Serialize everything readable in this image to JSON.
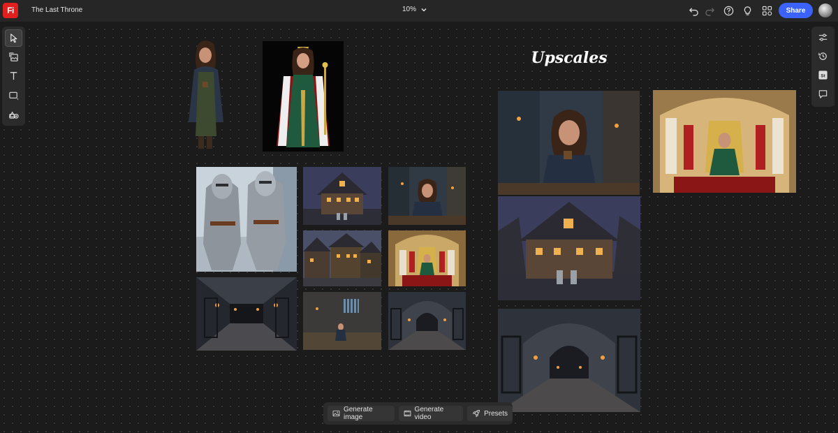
{
  "app": {
    "logo_text": "Fi",
    "document_title": "The Last Throne",
    "zoom_level": "10%"
  },
  "topbar": {
    "share_label": "Share",
    "icons": [
      "undo-icon",
      "redo-icon",
      "help-icon",
      "lightbulb-icon",
      "apps-icon"
    ]
  },
  "canvas": {
    "heading": "Upscales"
  },
  "left_toolbar": {
    "tools": [
      "select-tool",
      "add-image-tool",
      "text-tool",
      "shape-tool",
      "generate-tool"
    ]
  },
  "right_toolbar": {
    "tools": [
      "adjustments",
      "history",
      "stock",
      "comments"
    ],
    "stock_label": "St"
  },
  "bottom_bar": {
    "generate_image_label": "Generate image",
    "generate_video_label": "Generate video",
    "presets_label": "Presets"
  },
  "colors": {
    "accent": "#3b63fb",
    "logo": "#e0201e",
    "canvas_bg": "#1b1b1b",
    "panel_bg": "#2b2b2b"
  }
}
